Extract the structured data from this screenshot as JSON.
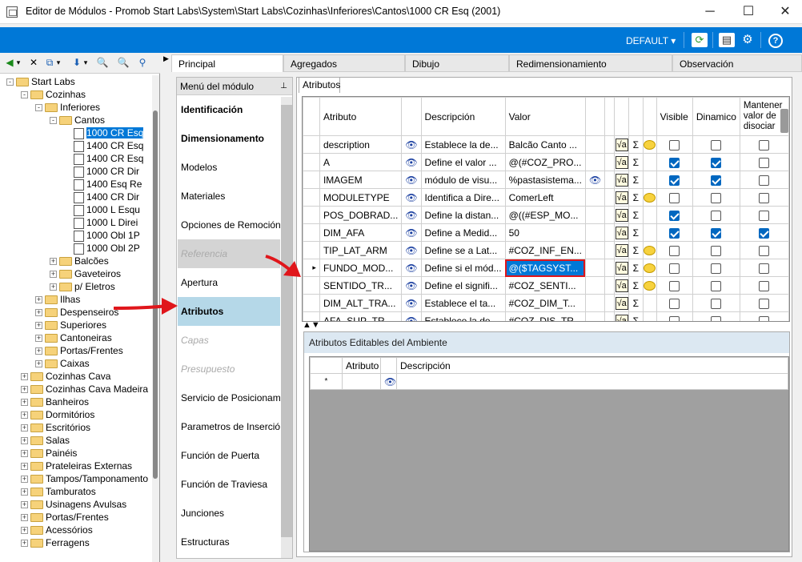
{
  "window": {
    "title": "Editor de Módulos - Promob Start Labs\\System\\Start Labs\\Cozinhas\\Inferiores\\Cantos\\1000 CR Esq (2001)",
    "min": "─",
    "max": "☐",
    "close": "✕"
  },
  "ribbon": {
    "profile": "DEFAULT",
    "profile_arrow": "▾",
    "refresh_icon": "⟳",
    "layout_icon": "▤",
    "settings_icon": "⚙",
    "help_icon": "?"
  },
  "toolbar": {
    "back": "◀",
    "back_arrow": "▾",
    "delete": "✕",
    "copy": "⧉",
    "copy_arrow": "▾",
    "down": "⬇",
    "down_arrow": "▾",
    "find": "🔍",
    "find2": "🔍",
    "tree": "⚲"
  },
  "tree": [
    {
      "label": "Start Labs",
      "indent": 0,
      "exp": "-",
      "type": "folder"
    },
    {
      "label": "Cozinhas",
      "indent": 1,
      "exp": "-",
      "type": "folder"
    },
    {
      "label": "Inferiores",
      "indent": 2,
      "exp": "-",
      "type": "folder"
    },
    {
      "label": "Cantos",
      "indent": 3,
      "exp": "-",
      "type": "folder"
    },
    {
      "label": "1000 CR Esq",
      "indent": 4,
      "exp": "",
      "type": "doc",
      "selected": true
    },
    {
      "label": "1400 CR Esq",
      "indent": 4,
      "exp": "",
      "type": "doc"
    },
    {
      "label": "1400 CR Esq",
      "indent": 4,
      "exp": "",
      "type": "doc"
    },
    {
      "label": "1000 CR Dir",
      "indent": 4,
      "exp": "",
      "type": "doc"
    },
    {
      "label": "1400 Esq Re",
      "indent": 4,
      "exp": "",
      "type": "doc"
    },
    {
      "label": "1400 CR Dir",
      "indent": 4,
      "exp": "",
      "type": "doc"
    },
    {
      "label": "1000 L Esqu",
      "indent": 4,
      "exp": "",
      "type": "doc"
    },
    {
      "label": "1000 L Direi",
      "indent": 4,
      "exp": "",
      "type": "doc"
    },
    {
      "label": "1000 Obl 1P",
      "indent": 4,
      "exp": "",
      "type": "doc"
    },
    {
      "label": "1000 Obl 2P",
      "indent": 4,
      "exp": "",
      "type": "doc"
    },
    {
      "label": "Balcões",
      "indent": 3,
      "exp": "+",
      "type": "folder"
    },
    {
      "label": "Gaveteiros",
      "indent": 3,
      "exp": "+",
      "type": "folder"
    },
    {
      "label": "p/ Eletros",
      "indent": 3,
      "exp": "+",
      "type": "folder"
    },
    {
      "label": "Ilhas",
      "indent": 2,
      "exp": "+",
      "type": "folder"
    },
    {
      "label": "Despenseiros",
      "indent": 2,
      "exp": "+",
      "type": "folder"
    },
    {
      "label": "Superiores",
      "indent": 2,
      "exp": "+",
      "type": "folder"
    },
    {
      "label": "Cantoneiras",
      "indent": 2,
      "exp": "+",
      "type": "folder"
    },
    {
      "label": "Portas/Frentes",
      "indent": 2,
      "exp": "+",
      "type": "folder"
    },
    {
      "label": "Caixas",
      "indent": 2,
      "exp": "+",
      "type": "folder"
    },
    {
      "label": "Cozinhas Cava",
      "indent": 1,
      "exp": "+",
      "type": "folder"
    },
    {
      "label": "Cozinhas Cava Madeira",
      "indent": 1,
      "exp": "+",
      "type": "folder"
    },
    {
      "label": "Banheiros",
      "indent": 1,
      "exp": "+",
      "type": "folder"
    },
    {
      "label": "Dormitórios",
      "indent": 1,
      "exp": "+",
      "type": "folder"
    },
    {
      "label": "Escritórios",
      "indent": 1,
      "exp": "+",
      "type": "folder"
    },
    {
      "label": "Salas",
      "indent": 1,
      "exp": "+",
      "type": "folder"
    },
    {
      "label": "Painéis",
      "indent": 1,
      "exp": "+",
      "type": "folder"
    },
    {
      "label": "Prateleiras Externas",
      "indent": 1,
      "exp": "+",
      "type": "folder"
    },
    {
      "label": "Tampos/Tamponamento",
      "indent": 1,
      "exp": "+",
      "type": "folder"
    },
    {
      "label": "Tamburatos",
      "indent": 1,
      "exp": "+",
      "type": "folder"
    },
    {
      "label": "Usinagens Avulsas",
      "indent": 1,
      "exp": "+",
      "type": "folder"
    },
    {
      "label": "Portas/Frentes",
      "indent": 1,
      "exp": "+",
      "type": "folder"
    },
    {
      "label": "Acessórios",
      "indent": 1,
      "exp": "+",
      "type": "folder"
    },
    {
      "label": "Ferragens",
      "indent": 1,
      "exp": "+",
      "type": "folder"
    }
  ],
  "tabs": [
    "Principal",
    "Agregados",
    "Dibujo",
    "Redimensionamiento",
    "Observación"
  ],
  "menu": {
    "header": "Menú del módulo",
    "pin": "⊥",
    "items": [
      {
        "label": "Identificación",
        "style": "bold"
      },
      {
        "label": "Dimensionamento",
        "style": "bold"
      },
      {
        "label": "Modelos",
        "style": ""
      },
      {
        "label": "Materiales",
        "style": ""
      },
      {
        "label": "Opciones de Remoción",
        "style": ""
      },
      {
        "label": "Referencia",
        "style": "disabled gray"
      },
      {
        "label": "Apertura",
        "style": ""
      },
      {
        "label": "Atributos",
        "style": "active"
      },
      {
        "label": "Capas",
        "style": "disabled"
      },
      {
        "label": "Presupuesto",
        "style": "disabled"
      },
      {
        "label": "Servicio de Posicionamiento",
        "style": ""
      },
      {
        "label": "Parametros de Inserción",
        "style": ""
      },
      {
        "label": "Función de Puerta",
        "style": ""
      },
      {
        "label": "Función de Traviesa",
        "style": ""
      },
      {
        "label": "Junciones",
        "style": ""
      },
      {
        "label": "Estructuras",
        "style": ""
      }
    ]
  },
  "attributes_tab": "Atributos",
  "grid": {
    "headers": {
      "attr": "Atributo",
      "desc": "Descripción",
      "val": "Valor",
      "visible": "Visible",
      "dyn": "Dinamico",
      "keep": "Mantener valor de disociar"
    },
    "rows": [
      {
        "attr": "description",
        "desc": "Establece la de...",
        "val": "Balcão Canto ...",
        "valbino": false,
        "bubble": true,
        "visible": false,
        "dyn": false,
        "keep": false
      },
      {
        "attr": "A",
        "desc": "Define el valor ...",
        "val": "@(#COZ_PRO...",
        "valbino": false,
        "bubble": false,
        "visible": true,
        "dyn": true,
        "keep": false
      },
      {
        "attr": "IMAGEM",
        "desc": "módulo de visu...",
        "val": "%pastasistema...",
        "valbino": true,
        "bubble": false,
        "visible": true,
        "dyn": true,
        "keep": false
      },
      {
        "attr": "MODULETYPE",
        "desc": "Identifica a Dire...",
        "val": "ComerLeft",
        "valbino": false,
        "bubble": true,
        "visible": false,
        "dyn": false,
        "keep": false
      },
      {
        "attr": "POS_DOBRAD...",
        "desc": "Define la distan...",
        "val": "@((#ESP_MO...",
        "valbino": false,
        "bubble": false,
        "visible": true,
        "dyn": false,
        "keep": false
      },
      {
        "attr": "DIM_AFA",
        "desc": "Define a Medid...",
        "val": "50",
        "valbino": false,
        "bubble": false,
        "visible": true,
        "dyn": true,
        "keep": true
      },
      {
        "attr": "TIP_LAT_ARM",
        "desc": "Define se a Lat...",
        "val": "#COZ_INF_EN...",
        "valbino": false,
        "bubble": true,
        "visible": false,
        "dyn": false,
        "keep": false
      },
      {
        "attr": "FUNDO_MOD...",
        "desc": "Define si el mód...",
        "val": "@($TAGSYST...",
        "valbino": false,
        "bubble": true,
        "visible": false,
        "dyn": false,
        "keep": false,
        "selected": true
      },
      {
        "attr": "SENTIDO_TR...",
        "desc": "Define el signifi...",
        "val": "#COZ_SENTI...",
        "valbino": false,
        "bubble": true,
        "visible": false,
        "dyn": false,
        "keep": false
      },
      {
        "attr": "DIM_ALT_TRA...",
        "desc": "Establece el ta...",
        "val": "#COZ_DIM_T...",
        "valbino": false,
        "bubble": false,
        "visible": false,
        "dyn": false,
        "keep": false
      },
      {
        "attr": "AFA_SUP_TR...",
        "desc": "Establece la de...",
        "val": "#COZ_DIS_TR...",
        "valbino": false,
        "bubble": false,
        "visible": false,
        "dyn": false,
        "keep": false
      }
    ]
  },
  "icons": {
    "bino": "👁",
    "sqrt": "√a",
    "sigma": "Σ",
    "row_pointer": "▸",
    "new_row": "*",
    "split_arrows": "▲▼"
  },
  "ambiente": {
    "title": "Atributos Editables del Ambiente",
    "attr": "Atributo",
    "desc": "Descripción"
  },
  "colors": {
    "accent": "#0078d7",
    "highlight": "#e0161b",
    "arrow": "#e0161b"
  }
}
